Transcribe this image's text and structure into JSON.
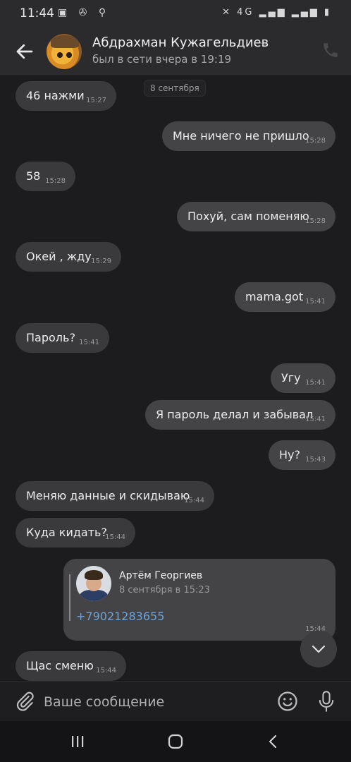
{
  "status_bar": {
    "time": "11:44",
    "left_icons": "▣ ✇ ⚲",
    "right_icons": "✕ 4G ▂▄▆ ▂▄▆ ▮"
  },
  "header": {
    "name": "Абдрахман Кужагельдиев",
    "status": "был в сети вчера в 19:19"
  },
  "chat": {
    "date_chip": "8 сентября",
    "messages": [
      {
        "dir": "in",
        "text": "46 нажми",
        "time": "15:27"
      },
      {
        "dir": "out",
        "text": "Мне ничего не пришло",
        "time": "15:28"
      },
      {
        "dir": "in",
        "text": "58",
        "time": "15:28"
      },
      {
        "dir": "out",
        "text": "Похуй, сам поменяю",
        "time": "15:28"
      },
      {
        "dir": "in",
        "text": "Окей , жду",
        "time": "15:29"
      },
      {
        "dir": "out",
        "text": "mama.got",
        "time": "15:41"
      },
      {
        "dir": "in",
        "text": "Пароль?",
        "time": "15:41"
      },
      {
        "dir": "out",
        "text": "Угу",
        "time": "15:41"
      },
      {
        "dir": "out",
        "text": "Я пароль делал и забывал",
        "time": "15:41"
      },
      {
        "dir": "out",
        "text": "Ну?",
        "time": "15:43"
      },
      {
        "dir": "in",
        "text": "Меняю данные и скидываю",
        "time": "15:44"
      },
      {
        "dir": "in",
        "text": "Куда кидать?",
        "time": "15:44"
      }
    ],
    "forwarded": {
      "author": "Артём Георгиев",
      "date": "8 сентября в 15:23",
      "phone": "+79021283655",
      "time": "15:44"
    },
    "last_message": {
      "dir": "in",
      "text": "Щас сменю",
      "time": "15:44"
    }
  },
  "input": {
    "placeholder": "Ваше сообщение"
  },
  "colors": {
    "background": "#1c1c1e",
    "bubble_in": "#3a3a3c",
    "bubble_out": "#444446",
    "link": "#6ea3d8"
  }
}
